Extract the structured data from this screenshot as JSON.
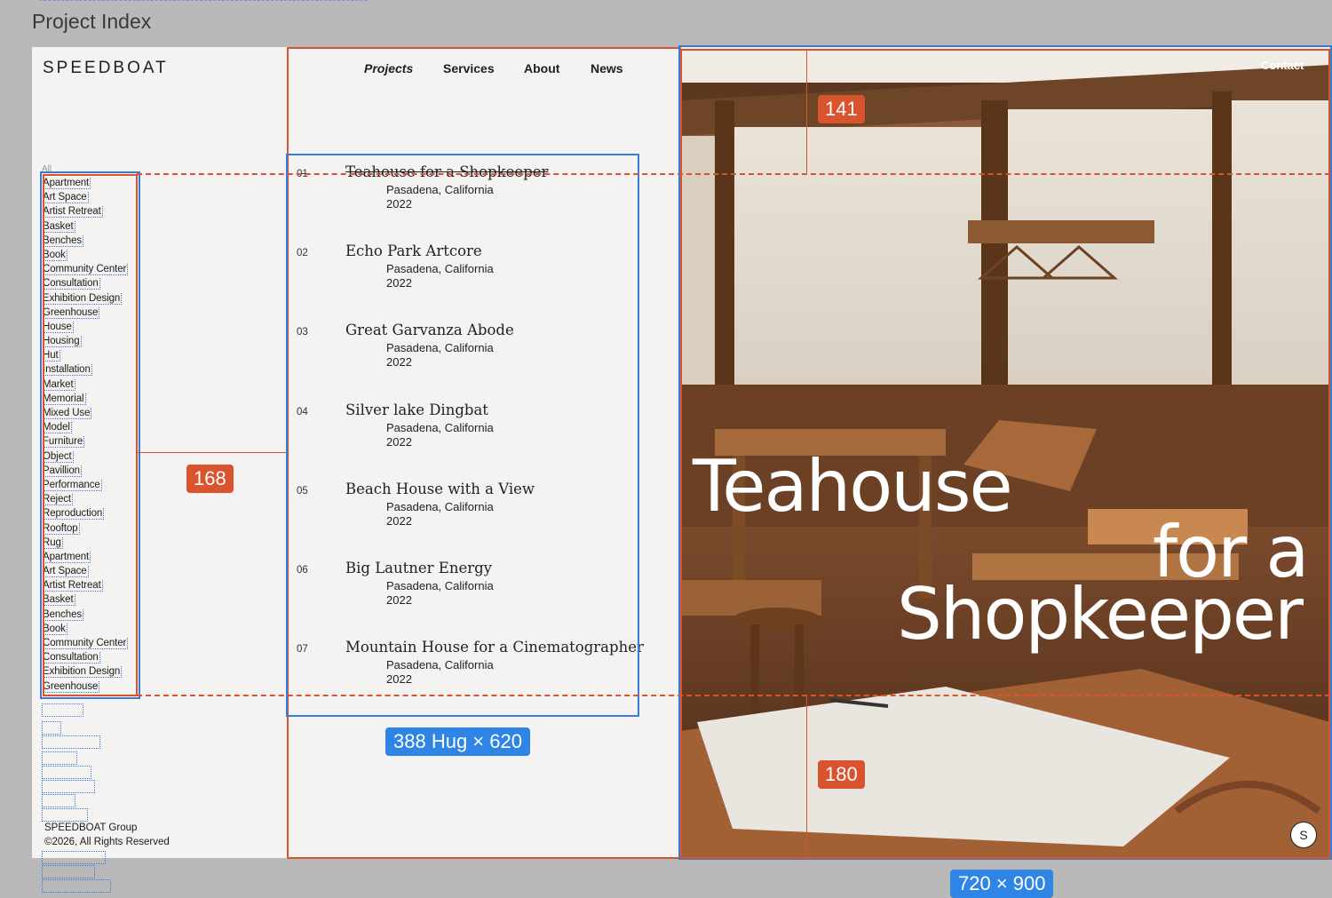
{
  "frame": {
    "title": "Project Index"
  },
  "site": {
    "logo": "SPEEDBOAT",
    "nav": {
      "projects": "Projects",
      "services": "Services",
      "about": "About",
      "news": "News",
      "contact": "Contact"
    }
  },
  "filters": {
    "all_label": "All",
    "items": [
      "Apartment",
      "Art Space",
      "Artist Retreat",
      "Basket",
      "Benches",
      "Book",
      "Community Center",
      "Consultation",
      "Exhibition Design",
      "Greenhouse",
      "House",
      "Housing",
      "Hut",
      "Installation",
      "Market",
      "Memorial",
      "Mixed Use",
      "Model",
      "Furniture",
      "Object",
      "Pavillion",
      "Performance",
      "Reject",
      "Reproduction",
      "Rooftop",
      "Rug",
      "Apartment",
      "Art Space",
      "Artist Retreat",
      "Basket",
      "Benches",
      "Book",
      "Community Center",
      "Consultation",
      "Exhibition Design",
      "Greenhouse"
    ]
  },
  "footer": {
    "group": "SPEEDBOAT Group",
    "rights": "©2026, All Rights Reserved"
  },
  "projects": [
    {
      "num": "01",
      "name": "Teahouse for a Shopkeeper",
      "location": "Pasadena, California",
      "year": "2022"
    },
    {
      "num": "02",
      "name": "Echo Park Artcore",
      "location": "Pasadena, California",
      "year": "2022"
    },
    {
      "num": "03",
      "name": "Great Garvanza Abode",
      "location": "Pasadena, California",
      "year": "2022"
    },
    {
      "num": "04",
      "name": "Silver lake Dingbat",
      "location": "Pasadena, California",
      "year": "2022"
    },
    {
      "num": "05",
      "name": "Beach House with a View",
      "location": "Pasadena, California",
      "year": "2022"
    },
    {
      "num": "06",
      "name": "Big Lautner Energy",
      "location": "Pasadena, California",
      "year": "2022"
    },
    {
      "num": "07",
      "name": "Mountain House for a Cinematographer",
      "location": "Pasadena, California",
      "year": "2022"
    }
  ],
  "hero": {
    "line1": "Teahouse",
    "line2": "for a",
    "line3": "Shopkeeper",
    "badge": "S"
  },
  "measurements": {
    "left_gap": "168",
    "top_gap": "141",
    "bottom_gap": "180",
    "list_size": "388 Hug × 620",
    "hero_size": "720 × 900"
  }
}
